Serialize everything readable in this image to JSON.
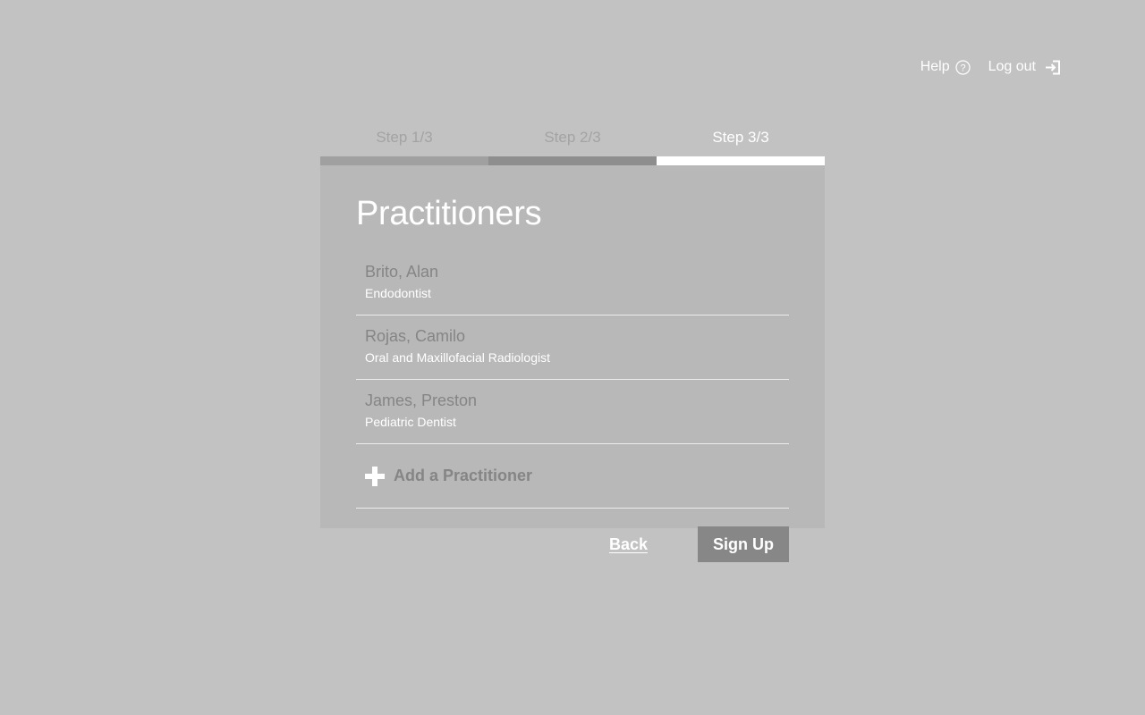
{
  "nav": {
    "help_label": "Help",
    "help_icon": "question-circle-icon",
    "logout_label": "Log out",
    "logout_icon": "sign-in-arrow-icon"
  },
  "steps": [
    {
      "label": "Step 1/3",
      "state": "complete"
    },
    {
      "label": "Step 2/3",
      "state": "complete"
    },
    {
      "label": "Step 3/3",
      "state": "current"
    }
  ],
  "card": {
    "title": "Practitioners",
    "practitioners": [
      {
        "name": "Brito, Alan",
        "role": "Endodontist"
      },
      {
        "name": "Rojas, Camilo",
        "role": "Oral and Maxillofacial Radiologist"
      },
      {
        "name": "James, Preston",
        "role": "Pediatric Dentist"
      }
    ],
    "add_label": "Add a Practitioner",
    "add_icon": "plus-icon",
    "back_label": "Back",
    "signup_label": "Sign Up"
  },
  "colors": {
    "background": "#c2c2c2",
    "card": "#b8b8b8",
    "active_step_bar": "#ffffff",
    "button": "#878787"
  }
}
